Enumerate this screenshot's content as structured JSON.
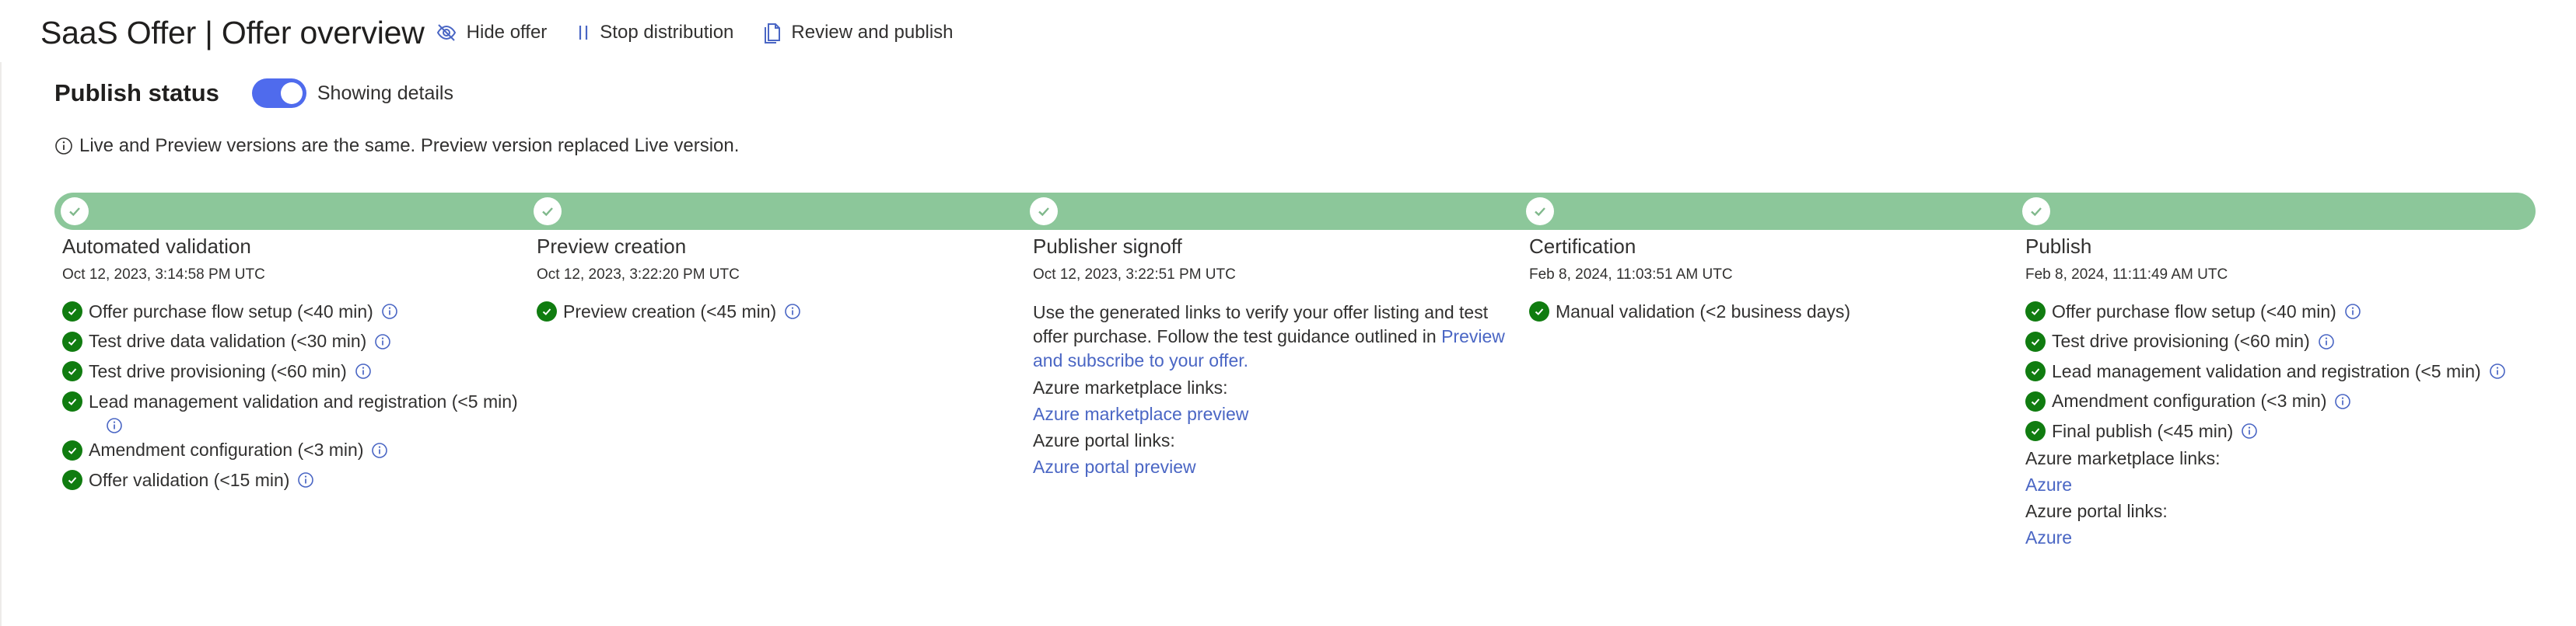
{
  "header": {
    "title": "SaaS Offer | Offer overview",
    "hide_offer": "Hide offer",
    "stop_distribution": "Stop distribution",
    "review_publish": "Review and publish"
  },
  "publish_status": {
    "title": "Publish status",
    "toggle_on": true,
    "toggle_label": "Showing details"
  },
  "info_message": "Live and Preview versions are the same. Preview version replaced Live version.",
  "colors": {
    "progress": "#8cc79a",
    "success": "#107c10",
    "link": "#4a66c4",
    "toggle": "#4f6bed"
  },
  "steps": {
    "automated_validation": {
      "title": "Automated validation",
      "date": "Oct 12, 2023, 3:14:58 PM UTC",
      "items": [
        "Offer purchase flow setup (<40 min)",
        "Test drive data validation (<30 min)",
        "Test drive provisioning (<60 min)",
        "Lead management validation and registration (<5 min)",
        "Amendment configuration (<3 min)",
        "Offer validation (<15 min)"
      ]
    },
    "preview_creation": {
      "title": "Preview creation",
      "date": "Oct 12, 2023, 3:22:20 PM UTC",
      "items": [
        "Preview creation (<45 min)"
      ]
    },
    "publisher_signoff": {
      "title": "Publisher signoff",
      "date": "Oct 12, 2023, 3:22:51 PM UTC",
      "text": "Use the generated links to verify your offer listing and test offer purchase. Follow the test guidance outlined in",
      "text_link": "Preview and subscribe to your offer.",
      "marketplace_label": "Azure marketplace links:",
      "marketplace_link": "Azure marketplace preview",
      "portal_label": "Azure portal links:",
      "portal_link": "Azure portal preview"
    },
    "certification": {
      "title": "Certification",
      "date": "Feb 8, 2024, 11:03:51 AM UTC",
      "items": [
        "Manual validation (<2 business days)"
      ]
    },
    "publish": {
      "title": "Publish",
      "date": "Feb 8, 2024, 11:11:49 AM UTC",
      "items": [
        "Offer purchase flow setup (<40 min)",
        "Test drive provisioning (<60 min)",
        "Lead management validation and registration (<5 min)",
        "Amendment configuration (<3 min)",
        "Final publish (<45 min)"
      ],
      "marketplace_label": "Azure marketplace links:",
      "marketplace_link": "Azure",
      "portal_label": "Azure portal links:",
      "portal_link": "Azure"
    }
  }
}
